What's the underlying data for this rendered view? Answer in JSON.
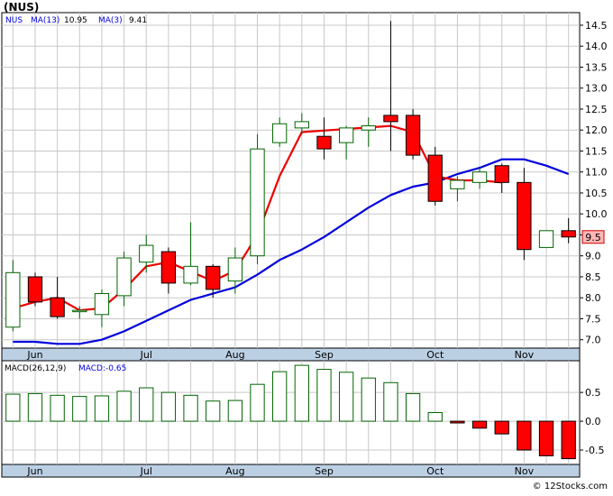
{
  "title": "(NUS)",
  "credit": "© 12Stocks.com",
  "colors": {
    "up_candle_fill": "#ffffff",
    "up_candle_stroke": "#006400",
    "down_candle_fill": "#ff0000",
    "ma13": "#0000dd",
    "ma3": "#ee0000",
    "macd_pos_stroke": "#006400",
    "macd_neg_fill": "#ff0000",
    "axis_band": "#bcd0e4",
    "grid": "#c8c8c8",
    "last_price_box": "#ffb6b6"
  },
  "chart_data": [
    {
      "type": "candlestick",
      "legend": {
        "ticker": "NUS",
        "ma13_label": "MA(13)",
        "ma13_value": "10.95",
        "ma3_label": "MA(3)",
        "ma3_value": "9.41"
      },
      "last_price_label": "9.5",
      "ylim": [
        6.8,
        14.8
      ],
      "y_ticks": [
        "7.0",
        "7.5",
        "8.0",
        "8.5",
        "9.0",
        "9.5",
        "10.0",
        "10.5",
        "11.0",
        "11.5",
        "12.0",
        "12.5",
        "13.0",
        "13.5",
        "14.0",
        "14.5"
      ],
      "month_labels": [
        "Jun",
        "Jul",
        "Aug",
        "Sep",
        "Oct",
        "Nov"
      ],
      "month_label_index": [
        1,
        6,
        10,
        14,
        19,
        23
      ],
      "weeks": 26,
      "candles": [
        {
          "o": 7.3,
          "h": 8.9,
          "l": 7.2,
          "c": 8.6
        },
        {
          "o": 8.5,
          "h": 8.6,
          "l": 7.8,
          "c": 7.9
        },
        {
          "o": 8.0,
          "h": 8.5,
          "l": 7.5,
          "c": 7.55
        },
        {
          "o": 7.7,
          "h": 7.8,
          "l": 7.5,
          "c": 7.7
        },
        {
          "o": 7.6,
          "h": 8.2,
          "l": 7.3,
          "c": 8.1
        },
        {
          "o": 8.05,
          "h": 9.1,
          "l": 7.8,
          "c": 8.95
        },
        {
          "o": 8.85,
          "h": 9.5,
          "l": 8.6,
          "c": 9.25
        },
        {
          "o": 9.1,
          "h": 9.2,
          "l": 8.1,
          "c": 8.35
        },
        {
          "o": 8.35,
          "h": 9.8,
          "l": 8.3,
          "c": 8.75
        },
        {
          "o": 8.75,
          "h": 8.8,
          "l": 8.0,
          "c": 8.2
        },
        {
          "o": 8.4,
          "h": 9.2,
          "l": 8.1,
          "c": 8.95
        },
        {
          "o": 9.0,
          "h": 11.9,
          "l": 8.8,
          "c": 11.55
        },
        {
          "o": 11.7,
          "h": 12.3,
          "l": 11.6,
          "c": 12.15
        },
        {
          "o": 12.05,
          "h": 12.4,
          "l": 11.9,
          "c": 12.2
        },
        {
          "o": 11.85,
          "h": 12.3,
          "l": 11.3,
          "c": 11.55
        },
        {
          "o": 11.7,
          "h": 12.1,
          "l": 11.3,
          "c": 12.05
        },
        {
          "o": 12.0,
          "h": 12.3,
          "l": 11.6,
          "c": 12.1
        },
        {
          "o": 12.35,
          "h": 14.6,
          "l": 11.5,
          "c": 12.2
        },
        {
          "o": 12.35,
          "h": 12.5,
          "l": 11.3,
          "c": 11.4
        },
        {
          "o": 11.4,
          "h": 11.6,
          "l": 10.2,
          "c": 10.3
        },
        {
          "o": 10.6,
          "h": 10.9,
          "l": 10.3,
          "c": 10.8
        },
        {
          "o": 10.75,
          "h": 11.1,
          "l": 10.6,
          "c": 11.0
        },
        {
          "o": 11.15,
          "h": 11.2,
          "l": 10.5,
          "c": 10.75
        },
        {
          "o": 10.75,
          "h": 11.1,
          "l": 8.9,
          "c": 9.15
        },
        {
          "o": 9.2,
          "h": 9.6,
          "l": 9.2,
          "c": 9.6
        },
        {
          "o": 9.6,
          "h": 9.9,
          "l": 9.3,
          "c": 9.45
        }
      ],
      "ma13": [
        {
          "i": 0,
          "v": 7.75
        },
        {
          "i": 1,
          "v": 7.9
        },
        {
          "i": 2,
          "v": 8.0
        },
        {
          "i": 3,
          "v": 7.7
        },
        {
          "i": 4,
          "v": 7.75
        },
        {
          "i": 5,
          "v": 8.2
        },
        {
          "i": 6,
          "v": 8.75
        },
        {
          "i": 7,
          "v": 8.85
        },
        {
          "i": 9,
          "v": 8.4
        },
        {
          "i": 10,
          "v": 8.65
        },
        {
          "i": 11,
          "v": 9.5
        },
        {
          "i": 12,
          "v": 10.9
        },
        {
          "i": 13,
          "v": 11.95
        },
        {
          "i": 17,
          "v": 12.1
        },
        {
          "i": 18,
          "v": 11.95
        },
        {
          "i": 19,
          "v": 10.9
        },
        {
          "i": 20,
          "v": 10.8
        },
        {
          "i": 21,
          "v": 10.8
        },
        {
          "i": 22,
          "v": 10.75
        }
      ],
      "ma3": [
        {
          "i": 0,
          "v": 6.95
        },
        {
          "i": 1,
          "v": 6.95
        },
        {
          "i": 2,
          "v": 6.9
        },
        {
          "i": 3,
          "v": 6.9
        },
        {
          "i": 4,
          "v": 7.0
        },
        {
          "i": 5,
          "v": 7.2
        },
        {
          "i": 6,
          "v": 7.45
        },
        {
          "i": 7,
          "v": 7.7
        },
        {
          "i": 8,
          "v": 7.95
        },
        {
          "i": 9,
          "v": 8.1
        },
        {
          "i": 10,
          "v": 8.25
        },
        {
          "i": 11,
          "v": 8.55
        },
        {
          "i": 12,
          "v": 8.9
        },
        {
          "i": 13,
          "v": 9.15
        },
        {
          "i": 14,
          "v": 9.45
        },
        {
          "i": 15,
          "v": 9.8
        },
        {
          "i": 16,
          "v": 10.15
        },
        {
          "i": 17,
          "v": 10.45
        },
        {
          "i": 18,
          "v": 10.65
        },
        {
          "i": 19,
          "v": 10.75
        },
        {
          "i": 20,
          "v": 10.95
        },
        {
          "i": 21,
          "v": 11.1
        },
        {
          "i": 22,
          "v": 11.3
        },
        {
          "i": 23,
          "v": 11.3
        },
        {
          "i": 24,
          "v": 11.15
        },
        {
          "i": 25,
          "v": 10.95
        }
      ]
    },
    {
      "type": "bar",
      "legend": {
        "label": "MACD(26,12,9)",
        "value_label": "MACD:-0.65"
      },
      "ylim": [
        -0.75,
        1.05
      ],
      "y_ticks": [
        "0.5",
        "0.0",
        "-0.5"
      ],
      "y_tick_values": [
        0.5,
        0.0,
        -0.5
      ],
      "values": [
        0.47,
        0.48,
        0.45,
        0.43,
        0.44,
        0.52,
        0.58,
        0.5,
        0.45,
        0.35,
        0.36,
        0.64,
        0.86,
        0.97,
        0.9,
        0.85,
        0.75,
        0.67,
        0.48,
        0.15,
        -0.03,
        -0.12,
        -0.22,
        -0.5,
        -0.6,
        -0.65
      ]
    }
  ]
}
